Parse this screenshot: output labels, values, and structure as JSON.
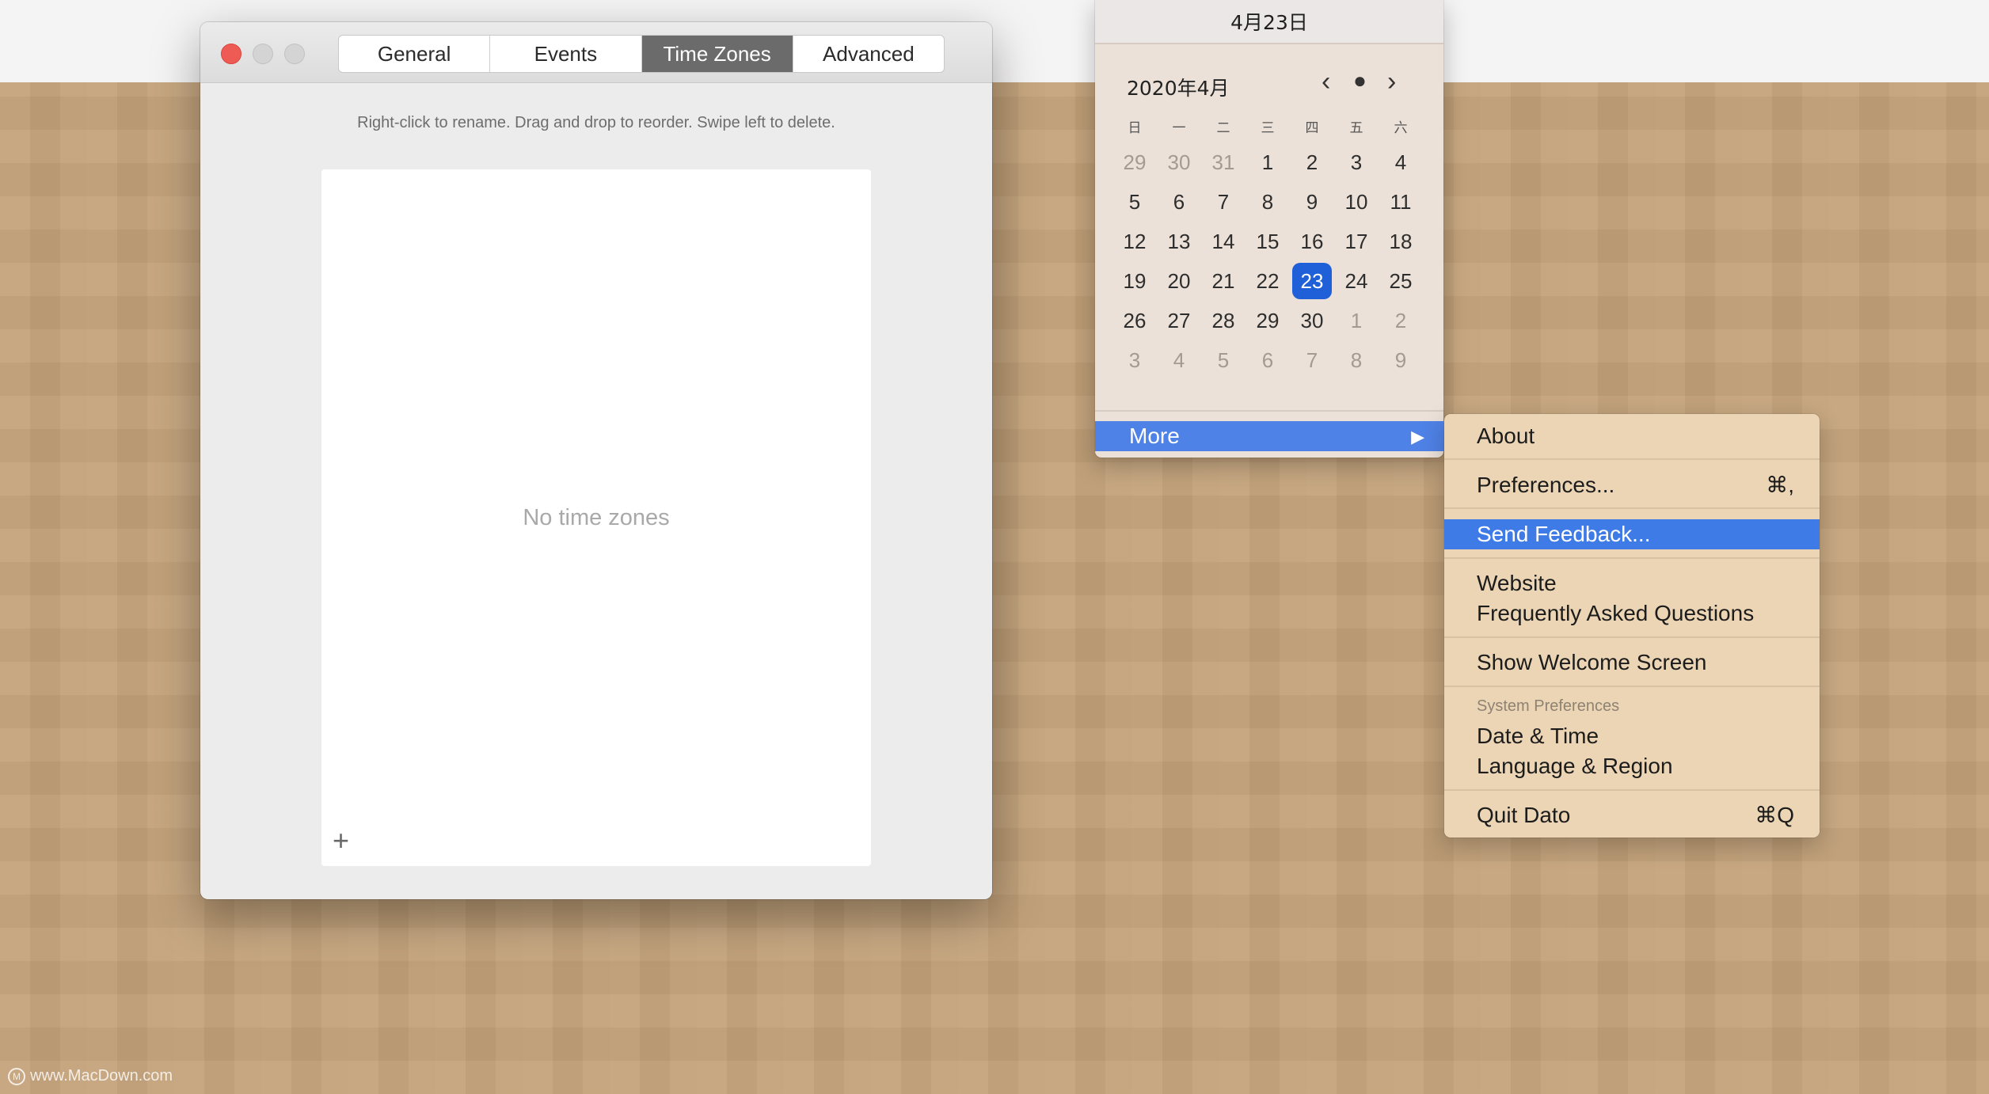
{
  "preferences": {
    "tabs": [
      "General",
      "Events",
      "Time Zones",
      "Advanced"
    ],
    "hint": "Right-click to rename. Drag and drop to reorder. Swipe left to delete.",
    "empty_text": "No time zones",
    "add_symbol": "+"
  },
  "calendar": {
    "header_date": "4月23日",
    "month_label": "2020年4月",
    "nav": {
      "prev": "‹",
      "today": "●",
      "next": "›"
    },
    "weekdays": [
      "日",
      "一",
      "二",
      "三",
      "四",
      "五",
      "六"
    ],
    "weeks": [
      [
        "29",
        "30",
        "31",
        "1",
        "2",
        "3",
        "4"
      ],
      [
        "5",
        "6",
        "7",
        "8",
        "9",
        "10",
        "11"
      ],
      [
        "12",
        "13",
        "14",
        "15",
        "16",
        "17",
        "18"
      ],
      [
        "19",
        "20",
        "21",
        "22",
        "23",
        "24",
        "25"
      ],
      [
        "26",
        "27",
        "28",
        "29",
        "30",
        "1",
        "2"
      ],
      [
        "3",
        "4",
        "5",
        "6",
        "7",
        "8",
        "9"
      ]
    ],
    "more_label": "More",
    "more_arrow": "▶"
  },
  "submenu": {
    "about": "About",
    "preferences": "Preferences...",
    "preferences_shortcut": "⌘,",
    "send_feedback": "Send Feedback...",
    "website": "Website",
    "faq": "Frequently Asked Questions",
    "welcome": "Show Welcome Screen",
    "sys_prefs_group": "System Preferences",
    "date_time": "Date & Time",
    "language_region": "Language & Region",
    "quit": "Quit Dato",
    "quit_shortcut": "⌘Q"
  },
  "watermark": "www.MacDown.com",
  "colors": {
    "accent": "#3f7be6",
    "today": "#1f60d8",
    "desktop": "#c3a27a"
  }
}
